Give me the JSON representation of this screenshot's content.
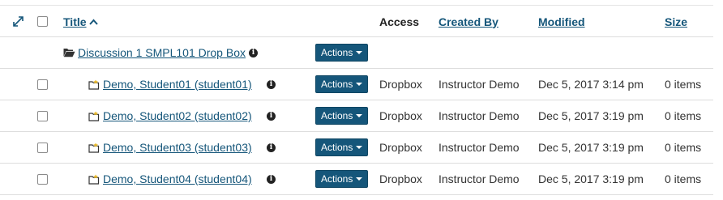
{
  "header": {
    "title": "Title",
    "access": "Access",
    "created_by": "Created By",
    "modified": "Modified",
    "size": "Size"
  },
  "folder": {
    "name": "Discussion 1 SMPL101 Drop Box",
    "actions_label": "Actions"
  },
  "rows": [
    {
      "name": "Demo, Student01 (student01)",
      "actions_label": "Actions",
      "access": "Dropbox",
      "created_by": "Instructor Demo",
      "modified": "Dec 5, 2017 3:14 pm",
      "size": "0 items"
    },
    {
      "name": "Demo, Student02 (student02)",
      "actions_label": "Actions",
      "access": "Dropbox",
      "created_by": "Instructor Demo",
      "modified": "Dec 5, 2017 3:19 pm",
      "size": "0 items"
    },
    {
      "name": "Demo, Student03 (student03)",
      "actions_label": "Actions",
      "access": "Dropbox",
      "created_by": "Instructor Demo",
      "modified": "Dec 5, 2017 3:19 pm",
      "size": "0 items"
    },
    {
      "name": "Demo, Student04 (student04)",
      "actions_label": "Actions",
      "access": "Dropbox",
      "created_by": "Instructor Demo",
      "modified": "Dec 5, 2017 3:19 pm",
      "size": "0 items"
    }
  ],
  "colors": {
    "link": "#15567a",
    "button": "#15567a",
    "folder_new": "#e8b82a"
  },
  "icons": {
    "expand": "expand-icon",
    "sort": "sort-ascending-icon",
    "folder_open": "folder-open-icon",
    "folder_new": "folder-new-icon",
    "info": "info-icon",
    "caret": "caret-down-icon"
  }
}
